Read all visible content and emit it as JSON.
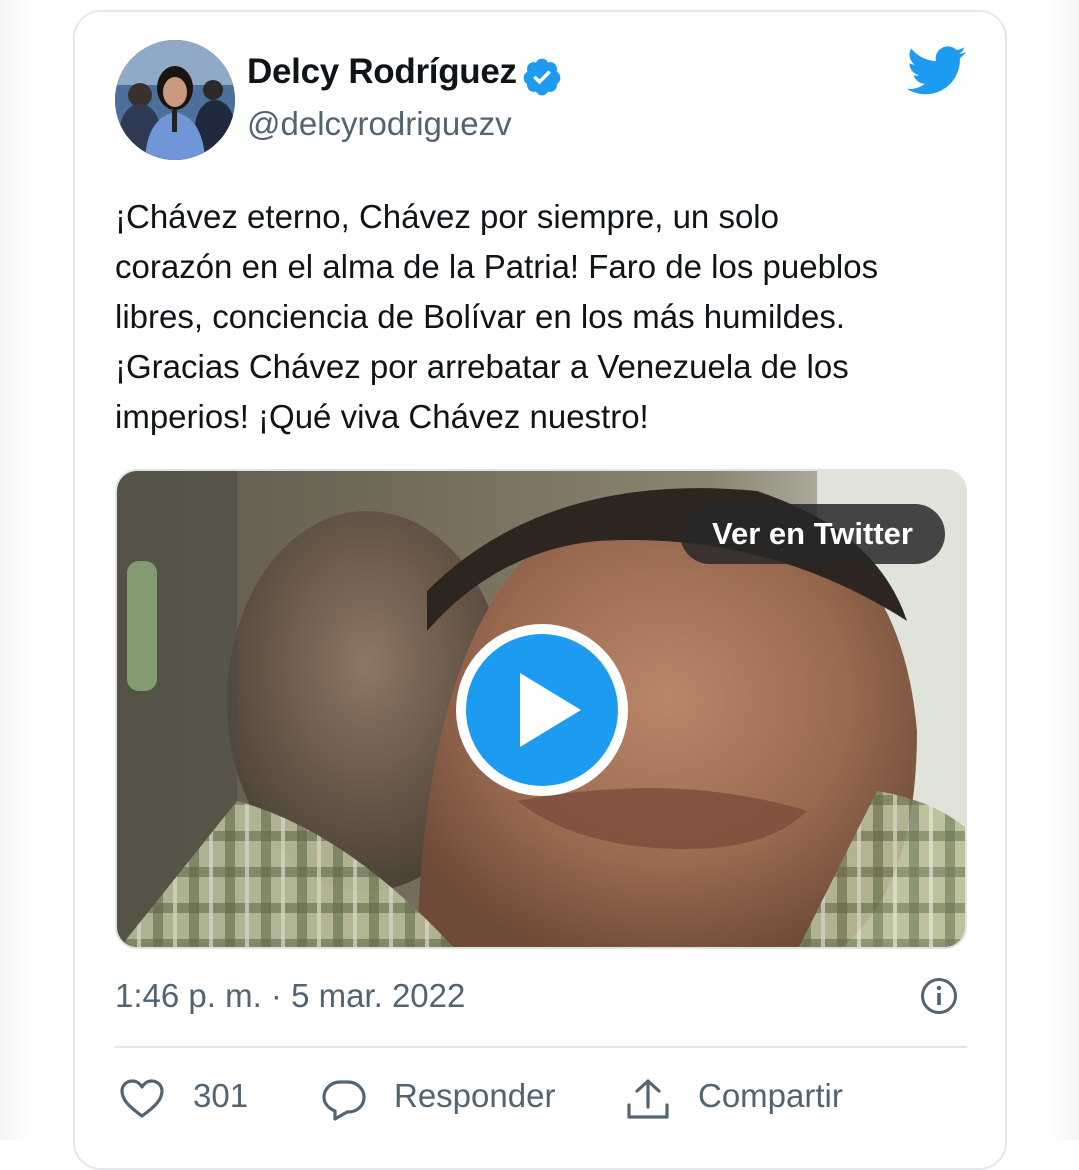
{
  "author": {
    "name": "Delcy Rodríguez",
    "handle": "@delcyrodriguezv",
    "verified": true
  },
  "tweet": {
    "lines": [
      "¡Chávez eterno, Chávez por siempre, un solo",
      "corazón en el alma de la Patria! Faro de los pueblos",
      "libres, conciencia de Bolívar en los más humildes.",
      "¡Gracias Chávez por arrebatar a Venezuela de los",
      "imperios! ¡Qué viva Chávez nuestro!"
    ]
  },
  "media": {
    "type": "video",
    "view_label": "Ver en Twitter",
    "play_icon": "play-icon"
  },
  "meta": {
    "timestamp": "1:46 p. m. · 5 mar. 2022"
  },
  "actions": {
    "like_count": "301",
    "reply_label": "Responder",
    "share_label": "Compartir"
  },
  "colors": {
    "twitter_blue": "#1d9bf0",
    "text_primary": "#0f1419",
    "text_secondary": "#536471"
  },
  "icons": [
    "verified-icon",
    "twitter-bird-icon",
    "play-icon",
    "info-icon",
    "heart-icon",
    "reply-icon",
    "share-icon"
  ]
}
